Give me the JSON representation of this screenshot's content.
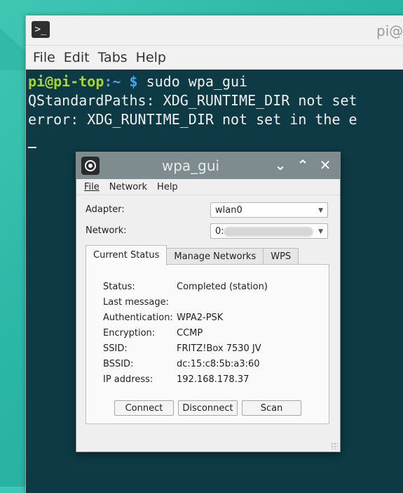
{
  "terminal": {
    "title": "pi@pi-top: ~",
    "menu": [
      "File",
      "Edit",
      "Tabs",
      "Help"
    ],
    "prompt_user": "pi@pi-top",
    "prompt_path": ":~ $",
    "command": " sudo wpa_gui",
    "output_lines": [
      "QStandardPaths: XDG_RUNTIME_DIR not set",
      "error: XDG_RUNTIME_DIR not set in the e"
    ]
  },
  "wpa_gui": {
    "title": "wpa_gui",
    "menu": [
      "File",
      "Network",
      "Help"
    ],
    "adapter_label": "Adapter:",
    "adapter_value": "wlan0",
    "network_label": "Network:",
    "network_value": "0:",
    "tabs": [
      "Current Status",
      "Manage Networks",
      "WPS"
    ],
    "status": [
      {
        "label": "Status:",
        "value": "Completed (station)"
      },
      {
        "label": "Last message:",
        "value": ""
      },
      {
        "label": "Authentication:",
        "value": "WPA2-PSK"
      },
      {
        "label": "Encryption:",
        "value": "CCMP"
      },
      {
        "label": "SSID:",
        "value": "FRITZ!Box 7530 JV"
      },
      {
        "label": "BSSID:",
        "value": "dc:15:c8:5b:a3:60"
      },
      {
        "label": "IP address:",
        "value": "192.168.178.37"
      }
    ],
    "buttons": {
      "connect": "Connect",
      "disconnect": "Disconnect",
      "scan": "Scan"
    }
  }
}
